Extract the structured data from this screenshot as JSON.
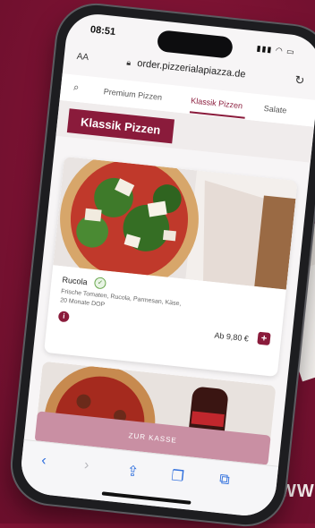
{
  "status": {
    "time": "08:51",
    "signal": "▮▮▮ ◠ ▭"
  },
  "browser": {
    "text_size_label": "AA",
    "url": "order.pizzerialapiazza.de"
  },
  "tabs": [
    {
      "label": "Premium Pizzen"
    },
    {
      "label": "Klassik Pizzen"
    },
    {
      "label": "Salate"
    }
  ],
  "section": {
    "title": "Klassik Pizzen"
  },
  "product": {
    "name": "Rucola",
    "description": "Frische Tomaten, Rucola, Parmesan, Käse, 20 Monate DOP",
    "price": "Ab 9,80 €"
  },
  "checkout": {
    "label": "ZUR KASSE"
  },
  "footer_text": "WW",
  "colors": {
    "brand": "#8a1b3b",
    "background": "#7e1334",
    "checkout": "#c98fa3"
  },
  "icons": [
    "search-icon",
    "lock-icon",
    "reload-icon",
    "veg-icon",
    "info-icon",
    "plus-icon",
    "back-icon",
    "forward-icon",
    "share-icon",
    "bookmarks-icon",
    "tabs-icon"
  ]
}
